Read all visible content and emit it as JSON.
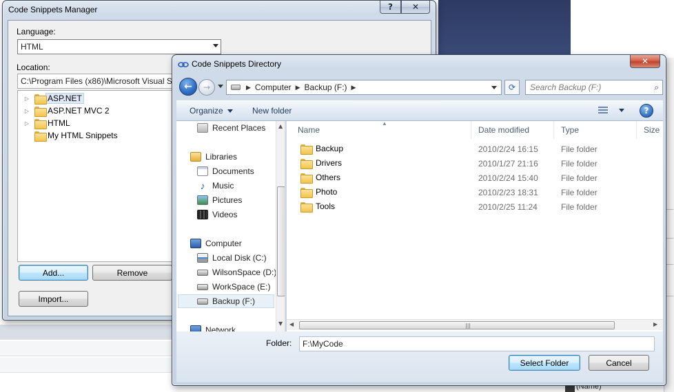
{
  "manager": {
    "title": "Code Snippets Manager",
    "help_glyph": "?",
    "close_glyph": "✕",
    "language_label": "Language:",
    "language_value": "HTML",
    "location_label": "Location:",
    "location_value": "C:\\Program Files (x86)\\Microsoft Visual St",
    "tree": [
      {
        "label": "ASP.NET",
        "expandable": true,
        "selected": true
      },
      {
        "label": "ASP.NET MVC 2",
        "expandable": true,
        "selected": false
      },
      {
        "label": "HTML",
        "expandable": true,
        "selected": false
      },
      {
        "label": "My HTML Snippets",
        "expandable": false,
        "selected": false
      }
    ],
    "add_label": "Add...",
    "remove_label": "Remove",
    "import_label": "Import..."
  },
  "dialog": {
    "title": "Code Snippets Directory",
    "close_glyph": "✕",
    "address": {
      "crumbs": [
        "Computer",
        "Backup (F:)"
      ]
    },
    "search_placeholder": "Search Backup (F:)",
    "toolbar": {
      "organize": "Organize",
      "new_folder": "New folder",
      "help_glyph": "?"
    },
    "nav": {
      "recent": "Recent Places",
      "libraries": "Libraries",
      "documents": "Documents",
      "music": "Music",
      "pictures": "Pictures",
      "videos": "Videos",
      "computer": "Computer",
      "local_disk": "Local Disk (C:)",
      "wilson": "WilsonSpace (D:)",
      "workspace": "WorkSpace (E:)",
      "backup": "Backup (F:)",
      "network": "Network"
    },
    "columns": {
      "name": "Name",
      "date": "Date modified",
      "type": "Type",
      "size": "Size"
    },
    "files": [
      {
        "name": "Backup",
        "date": "2010/2/24 16:15",
        "type": "File folder"
      },
      {
        "name": "Drivers",
        "date": "2010/1/27 21:16",
        "type": "File folder"
      },
      {
        "name": "Others",
        "date": "2010/2/24 15:40",
        "type": "File folder"
      },
      {
        "name": "Photo",
        "date": "2010/2/23 18:31",
        "type": "File folder"
      },
      {
        "name": "Tools",
        "date": "2010/2/25 11:24",
        "type": "File folder"
      }
    ],
    "folder_label": "Folder:",
    "folder_value": "F:\\MyCode",
    "select_label": "Select Folder",
    "cancel_label": "Cancel"
  },
  "background": {
    "corner_text": "(Name)"
  }
}
